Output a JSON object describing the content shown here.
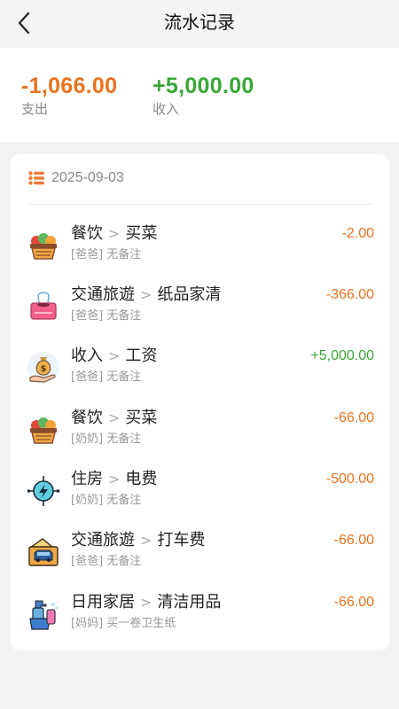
{
  "header": {
    "title": "流水记录"
  },
  "summary": {
    "expense": {
      "amount": "-1,066.00",
      "label": "支出"
    },
    "income": {
      "amount": "+5,000.00",
      "label": "收入"
    }
  },
  "colors": {
    "expense": "#e8731f",
    "income": "#3aa636"
  },
  "group": {
    "date": "2025-09-03"
  },
  "transactions": [
    {
      "category": "餐饮",
      "sep": ">",
      "subcategory": "买菜",
      "note": "[爸爸] 无备注",
      "amount": "-2.00",
      "type": "expense",
      "icon": "food-basket-icon"
    },
    {
      "category": "交通旅遊",
      "sep": ">",
      "subcategory": "纸品家清",
      "note": "[爸爸] 无备注",
      "amount": "-366.00",
      "type": "expense",
      "icon": "tissue-box-icon"
    },
    {
      "category": "收入",
      "sep": ">",
      "subcategory": "工资",
      "note": "[爸爸] 无备注",
      "amount": "+5,000.00",
      "type": "income",
      "icon": "money-bag-icon"
    },
    {
      "category": "餐饮",
      "sep": ">",
      "subcategory": "买菜",
      "note": "[奶奶] 无备注",
      "amount": "-66.00",
      "type": "expense",
      "icon": "food-basket-icon"
    },
    {
      "category": "住房",
      "sep": ">",
      "subcategory": "电费",
      "note": "[奶奶] 无备注",
      "amount": "-500.00",
      "type": "expense",
      "icon": "electricity-icon"
    },
    {
      "category": "交通旅遊",
      "sep": ">",
      "subcategory": "打车费",
      "note": "[爸爸] 无备注",
      "amount": "-66.00",
      "type": "expense",
      "icon": "taxi-ticket-icon"
    },
    {
      "category": "日用家居",
      "sep": ">",
      "subcategory": "清洁用品",
      "note": "[妈妈] 买一卷卫生纸",
      "amount": "-66.00",
      "type": "expense",
      "icon": "cleaning-supplies-icon"
    }
  ]
}
